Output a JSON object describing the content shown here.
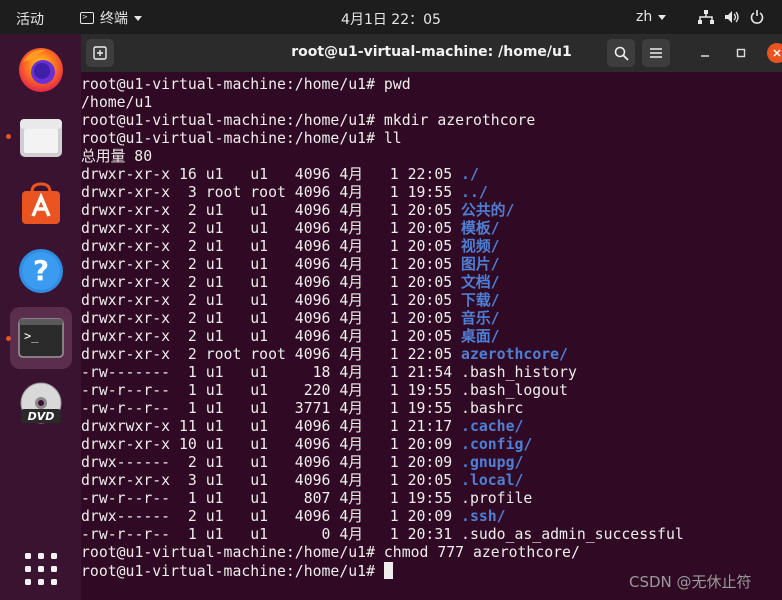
{
  "topbar": {
    "activities": "活动",
    "app_menu_label": "终端",
    "clock": "4月1日  22：05",
    "input_method": "zh"
  },
  "window": {
    "title": "root@u1-virtual-machine: /home/u1"
  },
  "dock": {
    "items": [
      "firefox",
      "files",
      "app-center",
      "help",
      "terminal",
      "dvd",
      "show-applications"
    ]
  },
  "terminal": {
    "lines": [
      {
        "text": "root@u1-virtual-machine:/home/u1# pwd",
        "name": ""
      },
      {
        "text": "/home/u1",
        "name": ""
      },
      {
        "text": "root@u1-virtual-machine:/home/u1# mkdir azerothcore",
        "name": ""
      },
      {
        "text": "root@u1-virtual-machine:/home/u1# ll",
        "name": ""
      },
      {
        "text": "总用量 80",
        "name": ""
      },
      {
        "text": "drwxr-xr-x 16 u1   u1   4096 4月   1 22:05 ",
        "name": "./",
        "dir": true
      },
      {
        "text": "drwxr-xr-x  3 root root 4096 4月   1 19:55 ",
        "name": "../",
        "dir": true
      },
      {
        "text": "drwxr-xr-x  2 u1   u1   4096 4月   1 20:05 ",
        "name": "公共的/",
        "dir": true
      },
      {
        "text": "drwxr-xr-x  2 u1   u1   4096 4月   1 20:05 ",
        "name": "模板/",
        "dir": true
      },
      {
        "text": "drwxr-xr-x  2 u1   u1   4096 4月   1 20:05 ",
        "name": "视频/",
        "dir": true
      },
      {
        "text": "drwxr-xr-x  2 u1   u1   4096 4月   1 20:05 ",
        "name": "图片/",
        "dir": true
      },
      {
        "text": "drwxr-xr-x  2 u1   u1   4096 4月   1 20:05 ",
        "name": "文档/",
        "dir": true
      },
      {
        "text": "drwxr-xr-x  2 u1   u1   4096 4月   1 20:05 ",
        "name": "下载/",
        "dir": true
      },
      {
        "text": "drwxr-xr-x  2 u1   u1   4096 4月   1 20:05 ",
        "name": "音乐/",
        "dir": true
      },
      {
        "text": "drwxr-xr-x  2 u1   u1   4096 4月   1 20:05 ",
        "name": "桌面/",
        "dir": true
      },
      {
        "text": "drwxr-xr-x  2 root root 4096 4月   1 22:05 ",
        "name": "azerothcore/",
        "dir": true
      },
      {
        "text": "-rw-------  1 u1   u1     18 4月   1 21:54 .bash_history",
        "name": ""
      },
      {
        "text": "-rw-r--r--  1 u1   u1    220 4月   1 19:55 .bash_logout",
        "name": ""
      },
      {
        "text": "-rw-r--r--  1 u1   u1   3771 4月   1 19:55 .bashrc",
        "name": ""
      },
      {
        "text": "drwxrwxr-x 11 u1   u1   4096 4月   1 21:17 ",
        "name": ".cache/",
        "dir": true
      },
      {
        "text": "drwxr-xr-x 10 u1   u1   4096 4月   1 20:09 ",
        "name": ".config/",
        "dir": true
      },
      {
        "text": "drwx------  2 u1   u1   4096 4月   1 20:09 ",
        "name": ".gnupg/",
        "dir": true
      },
      {
        "text": "drwxr-xr-x  3 u1   u1   4096 4月   1 20:05 ",
        "name": ".local/",
        "dir": true
      },
      {
        "text": "-rw-r--r--  1 u1   u1    807 4月   1 19:55 .profile",
        "name": ""
      },
      {
        "text": "drwx------  2 u1   u1   4096 4月   1 20:09 ",
        "name": ".ssh/",
        "dir": true
      },
      {
        "text": "-rw-r--r--  1 u1   u1      0 4月   1 20:31 .sudo_as_admin_successful",
        "name": ""
      },
      {
        "text": "root@u1-virtual-machine:/home/u1# chmod 777 azerothcore/",
        "name": ""
      }
    ],
    "prompt": "root@u1-virtual-machine:/home/u1# "
  },
  "watermark": "CSDN @无休止符",
  "colors": {
    "terminal_bg": "#300a24",
    "dir_blue": "#4f7fd4",
    "accent": "#e95420"
  }
}
